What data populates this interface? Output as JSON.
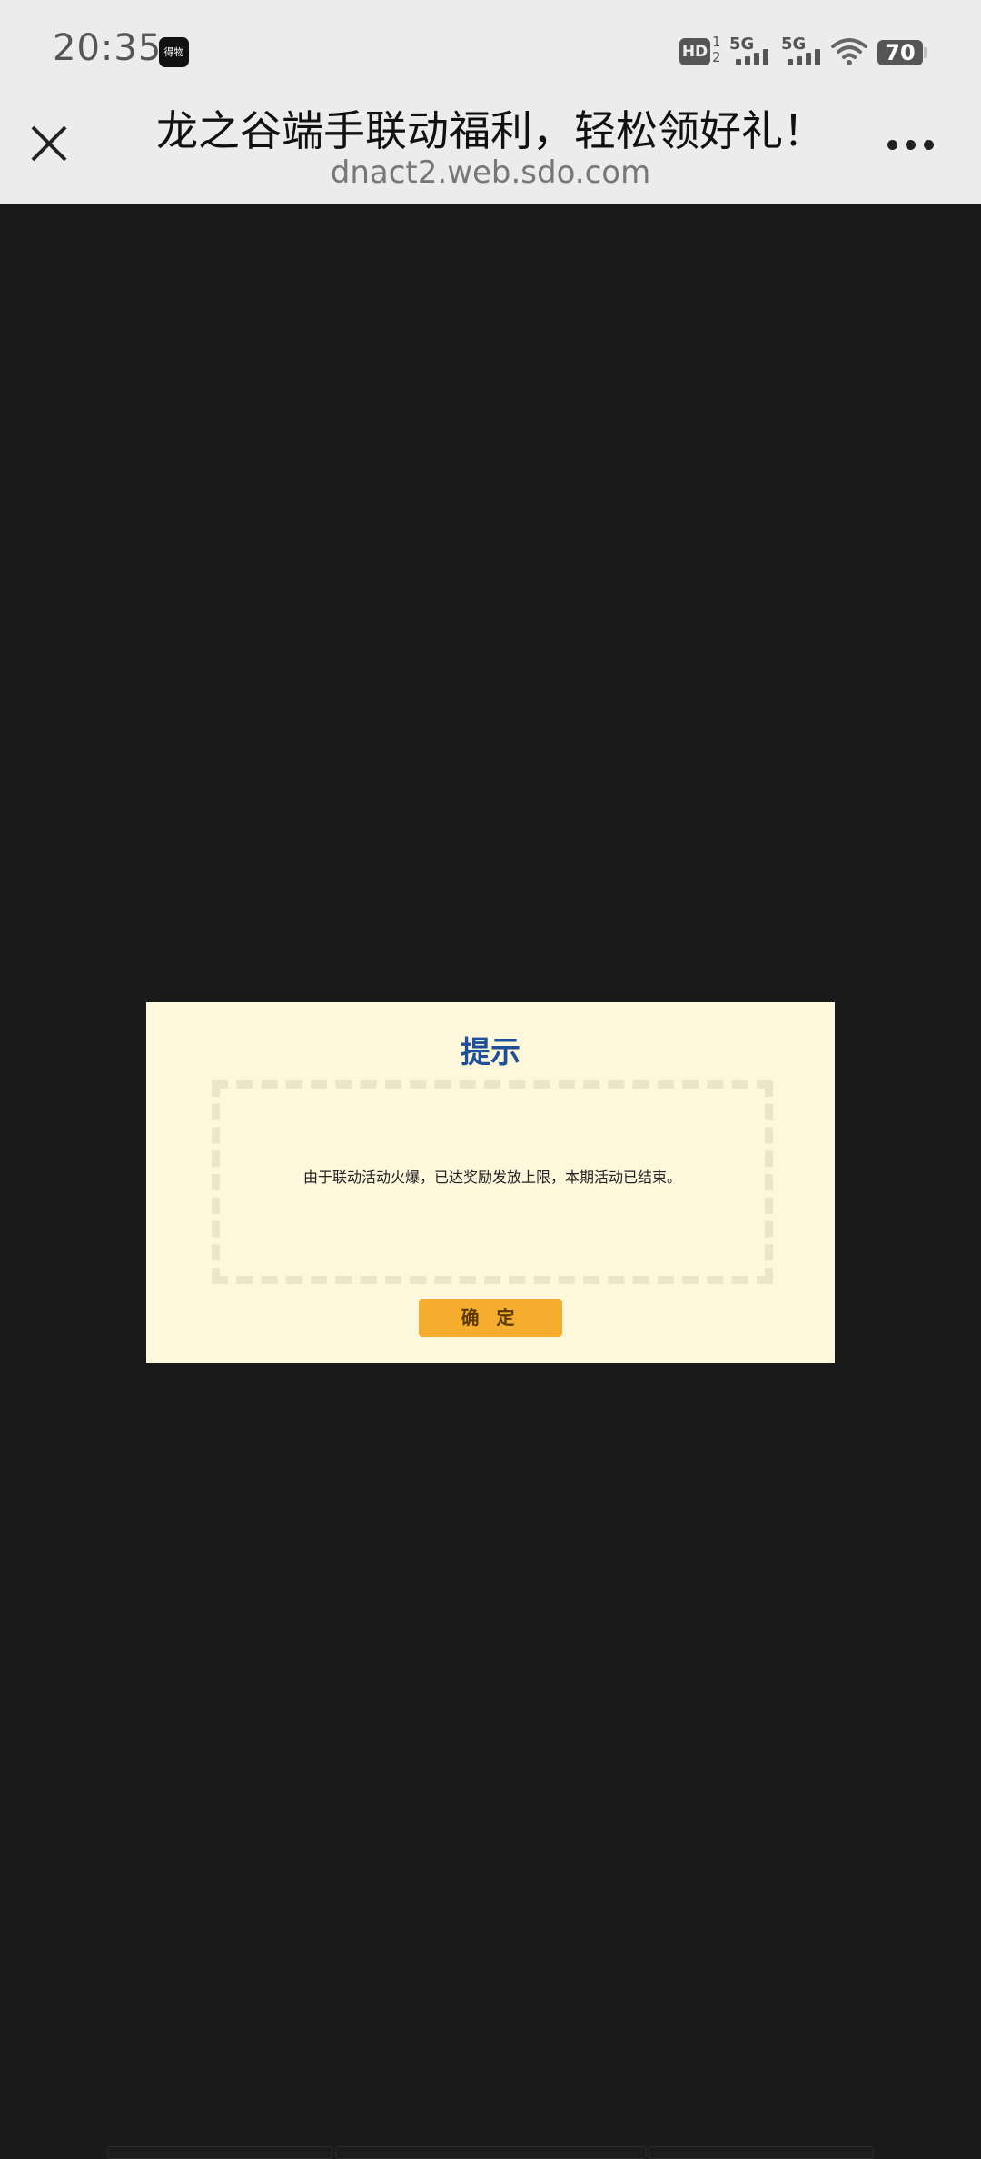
{
  "status_bar": {
    "time": "20:35",
    "app_badge": "得物",
    "hd_label": "HD",
    "hd_sub_top": "1",
    "hd_sub_bottom": "2",
    "signal1_label": "5G",
    "signal2_label": "5G",
    "battery": "70",
    "icons": [
      "app-badge-icon",
      "hd-icon",
      "signal-icon",
      "signal-icon",
      "wifi-icon",
      "battery-icon"
    ]
  },
  "header": {
    "title": "龙之谷端手联动福利，轻松领好礼！",
    "url": "dnact2.web.sdo.com",
    "close_icon": "close-icon",
    "more_icon": "more-icon"
  },
  "dialog": {
    "title": "提示",
    "message": "由于联动活动火爆，已达奖励发放上限，本期活动已结束。",
    "confirm_label": "确 定"
  },
  "colors": {
    "page_background": "#1a1a1a",
    "header_background": "#ececec",
    "dialog_background": "#fdf8dc",
    "dialog_title": "#1f4f98",
    "confirm_button": "#f6ac2c"
  }
}
